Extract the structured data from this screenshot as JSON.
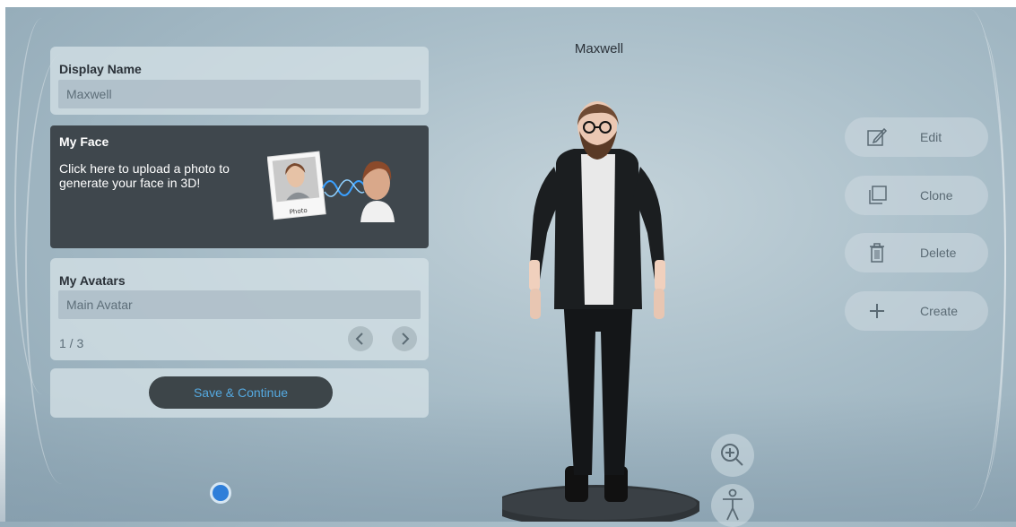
{
  "display_name": {
    "title": "Display Name",
    "value": "Maxwell"
  },
  "my_face": {
    "title": "My Face",
    "description": "Click here to upload a photo to generate your face in 3D!",
    "photo_caption": "Photo"
  },
  "my_avatars": {
    "title": "My Avatars",
    "selected": "Main Avatar",
    "pagination": "1 / 3",
    "prev_icon": "chevron-left-icon",
    "next_icon": "chevron-right-icon"
  },
  "save_button": {
    "label": "Save & Continue"
  },
  "avatar": {
    "name": "Maxwell"
  },
  "actions": [
    {
      "label": "Edit",
      "icon": "pencil-icon"
    },
    {
      "label": "Clone",
      "icon": "copy-icon"
    },
    {
      "label": "Delete",
      "icon": "trash-icon"
    },
    {
      "label": "Create",
      "icon": "plus-icon"
    }
  ],
  "view_controls": [
    {
      "icon": "zoom-in-icon"
    },
    {
      "icon": "full-body-icon"
    }
  ],
  "colors": {
    "accent_blue": "#55a9e0",
    "dark_panel": "#3f474d",
    "indicator": "#2e7ed9"
  }
}
